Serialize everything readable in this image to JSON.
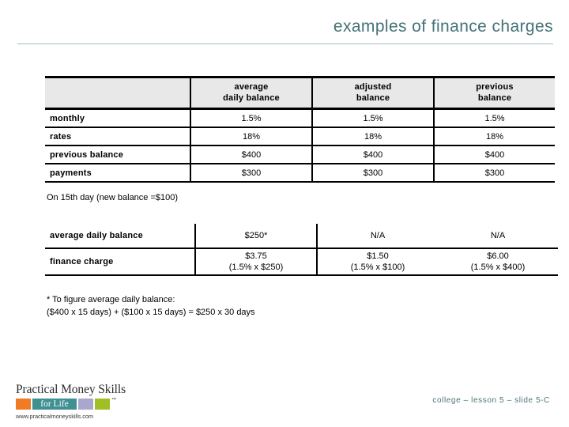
{
  "slide": {
    "title": "examples of finance charges",
    "footer_reference": "college – lesson 5 – slide 5-C"
  },
  "chart_data": {
    "type": "table",
    "title": "examples of finance charges",
    "tables": [
      {
        "name": "terms",
        "columns": [
          "",
          "average\ndaily balance",
          "adjusted\nbalance",
          "previous\nbalance"
        ],
        "rows": [
          {
            "label": "monthly",
            "values": [
              "1.5%",
              "1.5%",
              "1.5%"
            ]
          },
          {
            "label": "rates",
            "values": [
              "18%",
              "18%",
              "18%"
            ]
          },
          {
            "label": "previous balance",
            "values": [
              "$400",
              "$400",
              "$400"
            ]
          },
          {
            "label": "payments",
            "values": [
              "$300",
              "$300",
              "$300"
            ]
          }
        ]
      },
      {
        "name": "results",
        "note": "On 15th day (new balance =$100)",
        "rows": [
          {
            "label": "average daily balance",
            "values": [
              "$250*",
              "N/A",
              "N/A"
            ]
          },
          {
            "label": "finance charge",
            "values": [
              "$3.75",
              "$1.50",
              "$6.00"
            ],
            "subvalues": [
              "(1.5% x $250)",
              "(1.5% x $100)",
              "(1.5% x $400)"
            ]
          }
        ]
      }
    ]
  },
  "table_main": {
    "headers": {
      "blank": "",
      "col1_line1": "average",
      "col1_line2": "daily balance",
      "col2_line1": "adjusted",
      "col2_line2": "balance",
      "col3_line1": "previous",
      "col3_line2": "balance"
    },
    "rows": [
      {
        "label": "monthly",
        "v1": "1.5%",
        "v2": "1.5%",
        "v3": "1.5%"
      },
      {
        "label": "rates",
        "v1": "18%",
        "v2": "18%",
        "v3": "18%"
      },
      {
        "label": "previous balance",
        "v1": "$400",
        "v2": "$400",
        "v3": "$400"
      },
      {
        "label": "payments",
        "v1": "$300",
        "v2": "$300",
        "v3": "$300"
      }
    ]
  },
  "mid_note": "On 15th day (new balance =$100)",
  "table_second": {
    "rows": [
      {
        "label": "average daily balance",
        "v1": "$250*",
        "v2": "N/A",
        "v3": "N/A",
        "s1": "",
        "s2": "",
        "s3": ""
      },
      {
        "label": "finance charge",
        "v1": "$3.75",
        "v2": "$1.50",
        "v3": "$6.00",
        "s1": "(1.5% x $250)",
        "s2": "(1.5% x $100)",
        "s3": "(1.5% x $400)"
      }
    ]
  },
  "footnote": "* To figure average daily balance:\n($400 x 15 days) + ($100 x 15 days) = $250 x 30 days",
  "logo": {
    "wordmark": "Practical Money Skills",
    "for_life": "for Life",
    "trademark": "™",
    "url": "www.practicalmoneyskills.com",
    "colors": {
      "orange": "#ef7c24",
      "teal": "#3f8f93",
      "lavender": "#a9a6cf",
      "green": "#9fc024"
    }
  },
  "colors": {
    "title": "#437278",
    "rule": "#9fc0c5",
    "header_bg": "#e8e8e8",
    "footer": "#4b767c"
  }
}
